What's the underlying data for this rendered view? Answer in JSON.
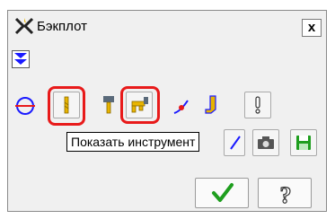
{
  "window": {
    "title": "Бэкплот",
    "close_label": "x"
  },
  "toolbar": {
    "buttons": [
      {
        "icon": "circle-section-icon"
      },
      {
        "icon": "show-tool-icon"
      },
      {
        "icon": "show-holder-icon"
      },
      {
        "icon": "show-tool-assembly-icon"
      },
      {
        "icon": "toolpath-point-icon"
      },
      {
        "icon": "tool-shape-icon"
      },
      {
        "icon": "info-exclamation-icon"
      },
      {
        "icon": "camera-icon"
      },
      {
        "icon": "save-icon"
      }
    ]
  },
  "tooltip": {
    "text": "Показать инструмент"
  },
  "footer": {
    "ok_icon": "checkmark-icon",
    "help_label": "?"
  },
  "colors": {
    "highlight": "#e81a1a",
    "accent_blue": "#1a1aff",
    "ok_green": "#1e9e1e",
    "tool_yellow": "#e8b400"
  }
}
